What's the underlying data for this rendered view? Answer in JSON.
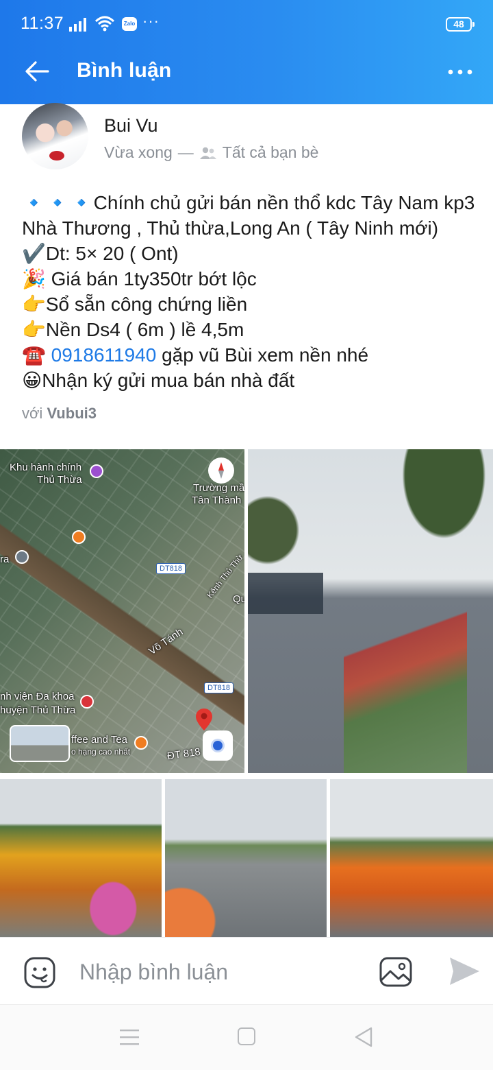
{
  "status_bar": {
    "time": "11:37",
    "zalo_badge": "Zalo",
    "more": "···",
    "battery": "48"
  },
  "header": {
    "title": "Bình luận"
  },
  "post": {
    "author": "Bui Vu",
    "time": "Vừa xong",
    "separator": "—",
    "audience": "Tất cả bạn bè",
    "lines": [
      {
        "emoji": "🔹🔹🔹",
        "text": "Chính chủ gửi bán nền thổ kdc Tây Nam kp3"
      },
      {
        "emoji": "",
        "text": "Nhà Thương , Thủ thừa,Long An ( Tây Ninh mới)"
      },
      {
        "emoji": "✔️",
        "text": "Dt: 5× 20 ( Ont)"
      },
      {
        "emoji": "🎉",
        "text": " Giá bán 1ty350tr bớt lộc"
      },
      {
        "emoji": "👉",
        "text": "Sổ sẵn công chứng liền"
      },
      {
        "emoji": "👉",
        "text": "Nền Ds4 ( 6m ) lề 4,5m"
      }
    ],
    "phone_line": {
      "emoji": "☎️",
      "phone": "0918611940",
      "text": " gặp vũ Bùi xem nền nhé"
    },
    "last_line": {
      "emoji": "😀",
      "text": "Nhận ký gửi mua bán nhà đất"
    },
    "with_prefix": "với",
    "tagged": "Vubui3"
  },
  "map": {
    "labels": {
      "admin": "Khu hành chính",
      "admin2": "Thủ Thừa",
      "school": "Trường mầ",
      "school2": "Tân Thành",
      "dt818_a": "DT818",
      "dt818_b": "DT818",
      "canal": "Kênh Thủ Thừ",
      "q": "Qu",
      "votanh": "Võ Tánh",
      "hospital": "nh viện Đa khoa",
      "hospital2": "huyện Thủ Thừa",
      "coffee": "ffee and Tea",
      "coffee2": "o hạng cao nhất",
      "dt818_road": "ĐT 818",
      "ra": "ra"
    }
  },
  "comment_bar": {
    "placeholder": "Nhập bình luận"
  },
  "colors": {
    "accent": "#1e78ea",
    "link": "#1e7ae6",
    "muted": "#8a8f96"
  },
  "icons": [
    "back-arrow-icon",
    "more-menu-icon",
    "friends-icon",
    "sticker-icon",
    "image-icon",
    "send-icon"
  ]
}
